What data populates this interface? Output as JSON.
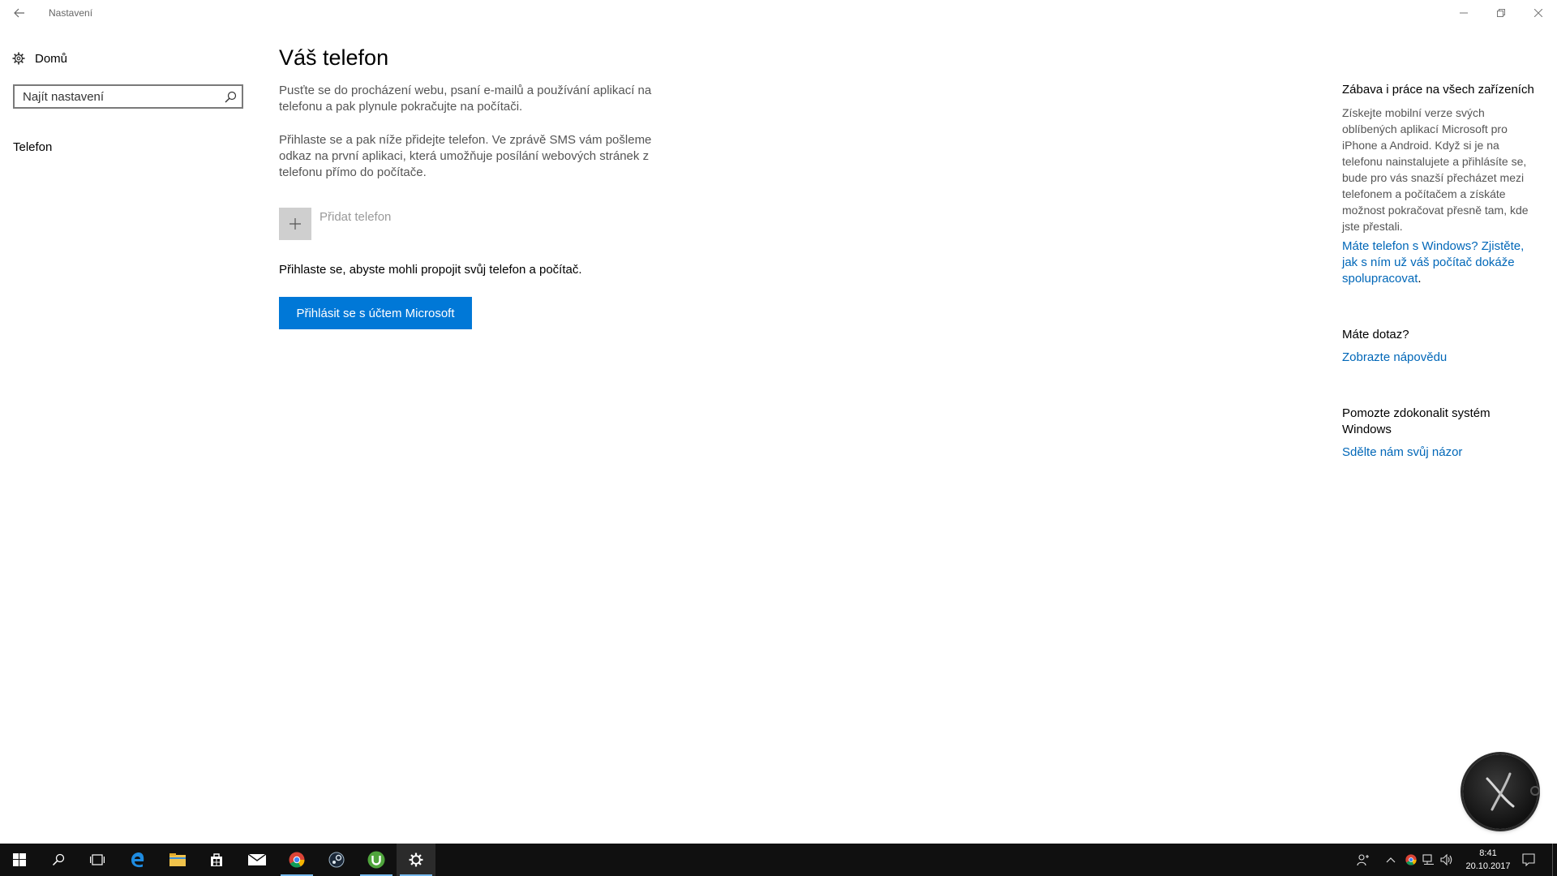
{
  "window": {
    "title": "Nastavení"
  },
  "sidebar": {
    "home_label": "Domů",
    "search_placeholder": "Najít nastavení",
    "nav_items": [
      {
        "label": "Telefon"
      }
    ]
  },
  "main": {
    "title": "Váš telefon",
    "description_1": "Pusťte se do procházení webu, psaní e-mailů a používání aplikací na telefonu a pak plynule pokračujte na počítači.",
    "description_2": "Přihlaste se a pak níže přidejte telefon. Ve zprávě SMS vám pošleme odkaz na první aplikaci, která umožňuje posílání webových stránek z telefonu přímo do počítače.",
    "add_phone_label": "Přidat telefon",
    "signin_note": "Přihlaste se, abyste mohli propojit svůj telefon a počítač.",
    "signin_button": "Přihlásit se s účtem Microsoft"
  },
  "right_panel": {
    "section1_heading": "Zábava i práce na všech zařízeních",
    "section1_text": "Získejte mobilní verze svých oblíbených aplikací Microsoft pro iPhone a Android. Když si je na telefonu nainstalujete a přihlásíte se, bude pro vás snazší přecházet mezi telefonem a počítačem a získáte možnost pokračovat přesně tam, kde jste přestali.",
    "section1_link": "Máte telefon s Windows? Zjistěte, jak s ním už váš počítač dokáže spolupracovat",
    "section1_link_suffix": ".",
    "section2_heading": "Máte dotaz?",
    "section2_link": "Zobrazte nápovědu",
    "section3_heading": "Pomozte zdokonalit systém Windows",
    "section3_link": "Sdělte nám svůj názor"
  },
  "taskbar": {
    "items": [
      "start-icon",
      "search-icon",
      "task-view-icon",
      "edge-icon",
      "file-explorer-icon",
      "store-icon",
      "mail-icon",
      "chrome-icon",
      "steam-icon",
      "utorrent-icon",
      "settings-icon"
    ],
    "clock_time": "8:41",
    "clock_date": "20.10.2017"
  },
  "colors": {
    "accent": "#0078d7",
    "link": "#0067b8",
    "taskbar": "#101010"
  }
}
